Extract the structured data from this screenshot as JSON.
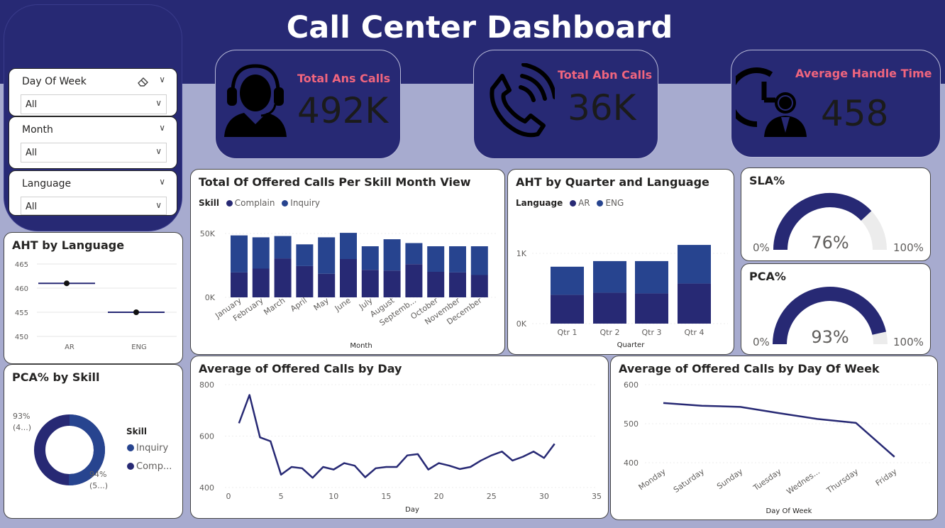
{
  "title": "Call Center Dashboard",
  "colors": {
    "dark": "#272974",
    "series1": "#272974",
    "series2": "#27448f",
    "kpi_label": "#f0657e",
    "gauge_track": "#ececec"
  },
  "slicers": [
    {
      "label": "Day Of Week",
      "value": "All",
      "icons": [
        "eraser-icon",
        "chevron-down-icon"
      ]
    },
    {
      "label": "Month",
      "value": "All"
    },
    {
      "label": "Language",
      "value": "All"
    }
  ],
  "kpis": {
    "ans": {
      "label": "Total Ans Calls",
      "value": "492K",
      "icon": "headset-agent-icon"
    },
    "abn": {
      "label": "Total Abn Calls",
      "value": "36K",
      "icon": "phone-ringing-icon"
    },
    "aht": {
      "label": "Average Handle Time",
      "value": "458",
      "icon": "clock-person-icon"
    }
  },
  "cards": {
    "aht_language": "AHT by Language",
    "pca_skill": "PCA% by Skill",
    "offered_month": "Total Of Offered Calls Per Skill Month View",
    "aht_quarter": "AHT by Quarter and Language",
    "sla": "SLA%",
    "pca": "PCA%",
    "avg_day": "Average of Offered Calls by Day",
    "avg_dow": "Average of Offered Calls by Day Of Week"
  },
  "chart_data": [
    {
      "id": "aht_by_language",
      "type": "scatter",
      "title": "AHT by Language",
      "categories": [
        "AR",
        "ENG"
      ],
      "values": [
        461,
        455
      ],
      "yticks": [
        450,
        455,
        460,
        465
      ],
      "ylim": [
        450,
        465
      ]
    },
    {
      "id": "pca_by_skill",
      "type": "pie",
      "title": "PCA% by Skill",
      "legend_title": "Skill",
      "legend": [
        "Inquiry",
        "Comp..."
      ],
      "labels": [
        {
          "line1": "94%",
          "line2": "(5...)"
        },
        {
          "line1": "93%",
          "line2": "(4...)"
        }
      ],
      "values": [
        94,
        93
      ]
    },
    {
      "id": "offered_per_skill_month",
      "type": "bar",
      "title": "Total Of Offered Calls Per Skill Month View",
      "legend_title": "Skill",
      "xlabel": "Month",
      "categories": [
        "January",
        "February",
        "March",
        "April",
        "May",
        "June",
        "July",
        "August",
        "Septemb...",
        "October",
        "November",
        "December"
      ],
      "series": [
        {
          "name": "Complain",
          "values": [
            19.5,
            22.5,
            30.5,
            24.5,
            18.5,
            30,
            21.5,
            21,
            26,
            20,
            19.5,
            17.5
          ]
        },
        {
          "name": "Inquiry",
          "values": [
            29,
            24.5,
            17.5,
            17,
            28.5,
            20.5,
            18.5,
            24.5,
            16.5,
            20,
            20.5,
            22.5
          ]
        }
      ],
      "yticks": [
        "0K",
        "50K"
      ],
      "ylim": [
        0,
        50
      ]
    },
    {
      "id": "aht_by_quarter_language",
      "type": "bar",
      "title": "AHT by Quarter and Language",
      "legend_title": "Language",
      "xlabel": "Quarter",
      "categories": [
        "Qtr 1",
        "Qtr 2",
        "Qtr 3",
        "Qtr 4"
      ],
      "series": [
        {
          "name": "AR",
          "values": [
            410,
            440,
            430,
            570
          ]
        },
        {
          "name": "ENG",
          "values": [
            400,
            450,
            460,
            550
          ]
        }
      ],
      "yticks": [
        "0K",
        "1K"
      ],
      "ylim": [
        0,
        1000
      ]
    },
    {
      "id": "sla_gauge",
      "type": "gauge",
      "title": "SLA%",
      "value": 76,
      "value_label": "76%",
      "min_label": "0%",
      "max_label": "100%"
    },
    {
      "id": "pca_gauge",
      "type": "gauge",
      "title": "PCA%",
      "value": 93,
      "value_label": "93%",
      "min_label": "0%",
      "max_label": "100%"
    },
    {
      "id": "avg_offered_by_day",
      "type": "line",
      "title": "Average of Offered Calls by Day",
      "xlabel": "Day",
      "x": [
        1,
        2,
        3,
        4,
        5,
        6,
        7,
        8,
        9,
        10,
        11,
        12,
        13,
        14,
        15,
        16,
        17,
        18,
        19,
        20,
        21,
        22,
        23,
        24,
        25,
        26,
        27,
        28,
        29,
        30,
        31
      ],
      "y": [
        650,
        760,
        595,
        580,
        450,
        480,
        475,
        438,
        480,
        470,
        495,
        485,
        440,
        475,
        480,
        480,
        525,
        530,
        470,
        495,
        485,
        472,
        480,
        505,
        525,
        540,
        505,
        520,
        540,
        515,
        570
      ],
      "xticks": [
        0,
        5,
        10,
        15,
        20,
        25,
        30,
        35
      ],
      "xlim": [
        0,
        35
      ],
      "yticks": [
        400,
        600,
        800
      ],
      "ylim": [
        400,
        800
      ]
    },
    {
      "id": "avg_offered_by_dow",
      "type": "line",
      "title": "Average of Offered Calls by Day Of Week",
      "xlabel": "Day Of Week",
      "categories": [
        "Monday",
        "Saturday",
        "Sunday",
        "Tuesday",
        "Wednes...",
        "Thursday",
        "Friday"
      ],
      "values": [
        553,
        546,
        543,
        527,
        512,
        502,
        415
      ],
      "yticks": [
        400,
        500,
        600
      ],
      "ylim": [
        400,
        600
      ]
    }
  ]
}
